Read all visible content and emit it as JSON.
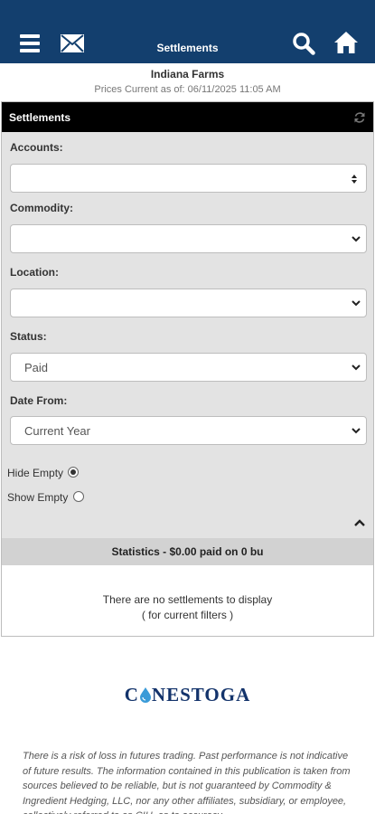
{
  "header": {
    "title": "Settlements",
    "icons": [
      "menu-icon",
      "mail-icon",
      "search-icon",
      "home-icon"
    ]
  },
  "account_info": {
    "name": "Indiana Farms",
    "prices_current": "Prices Current as of: 06/11/2025 11:05 AM"
  },
  "panel": {
    "title": "Settlements",
    "fields": {
      "accounts": {
        "label": "Accounts:",
        "value": ""
      },
      "commodity": {
        "label": "Commodity:",
        "value": ""
      },
      "location": {
        "label": "Location:",
        "value": ""
      },
      "status": {
        "label": "Status:",
        "value": "Paid"
      },
      "date_from": {
        "label": "Date From:",
        "value": "Current Year"
      }
    },
    "radio": {
      "hide_empty": {
        "label": "Hide Empty",
        "checked": true
      },
      "show_empty": {
        "label": "Show Empty",
        "checked": false
      }
    },
    "statistics": "Statistics - $0.00 paid on 0 bu",
    "empty_message": "There are no settlements to display",
    "empty_sub": "( for current filters )"
  },
  "footer": {
    "logo_prefix": "C",
    "logo_suffix": "NESTOGA",
    "disclaimer": "There is a risk of loss in futures trading. Past performance is not indicative of future results. The information contained in this publication is taken from sources believed to be reliable, but is not guaranteed by Commodity & Ingredient Hedging, LLC, nor any other affiliates, subsidiary, or employee, collectively referred to as CIH, as to accuracy"
  },
  "colors": {
    "header_bg": "#133f6e",
    "panel_bg": "#e3e3e3",
    "logo": "#13336b",
    "logo_drop": "#3a9bd8"
  }
}
